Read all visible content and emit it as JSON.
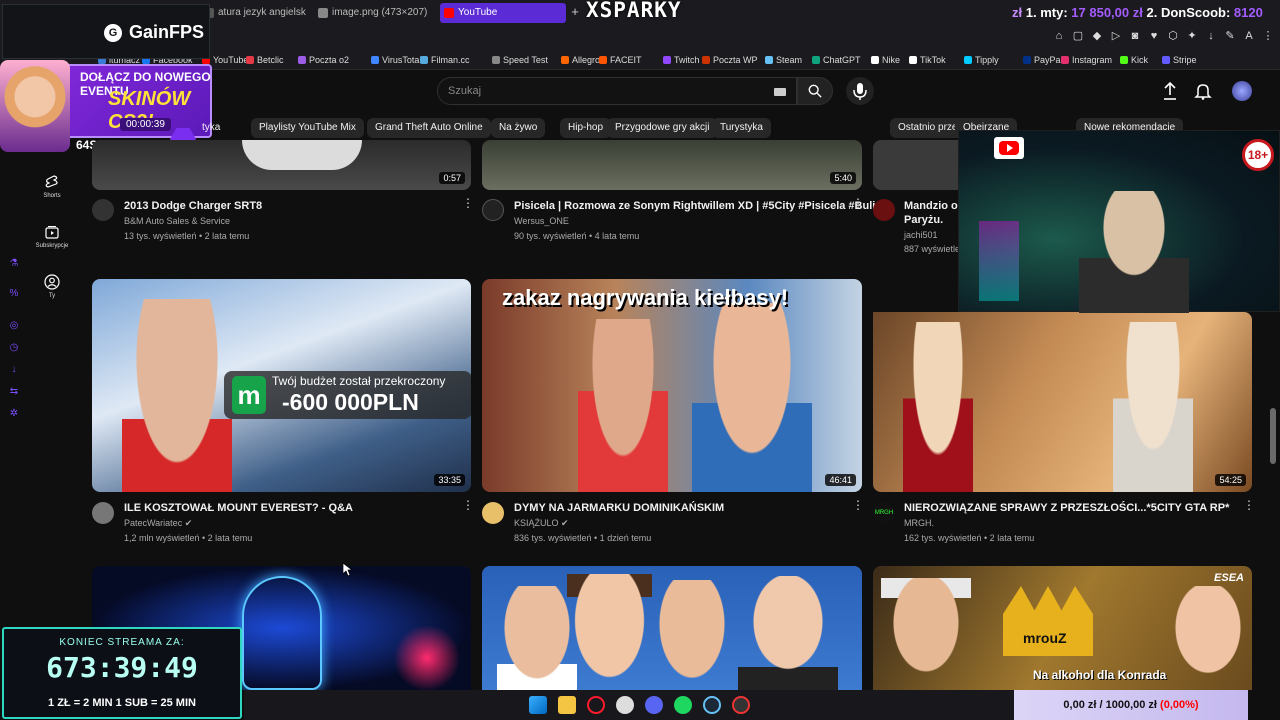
{
  "browser": {
    "tabs": [
      {
        "label": "atura jezyk angielski 202"
      },
      {
        "label": "image.png (473×207)"
      },
      {
        "label": "YouTube"
      }
    ],
    "overlay_title": "XSPARKY",
    "donors": {
      "rank1": "1.",
      "name1": "mty:",
      "amt1": "17 850,00 zł",
      "rank2": "2.",
      "name2": "DonScoob:",
      "amt2": "8120",
      "prefix": "zł"
    },
    "bookmarks": [
      "itumacz",
      "Facebook",
      "YouTube",
      "Betclic",
      "Poczta o2",
      "VirusTotal",
      "Filman.cc",
      "Speed Test",
      "Allegro",
      "FACEIT",
      "Twitch",
      "Poczta WP",
      "Steam",
      "ChatGPT",
      "Nike",
      "TikTok",
      "Tipply",
      "PayPal",
      "Instagram",
      "Kick",
      "Stripe"
    ]
  },
  "gainfps": {
    "label": "GainFPS"
  },
  "promo": {
    "line1": "DOŁĄCZ DO NOWEGO EVENTU",
    "line2": "SKINÓW CS2!",
    "timer": "00:00:39",
    "brand": "64SKINS"
  },
  "youtube": {
    "search_placeholder": "Szukaj",
    "chips": [
      "tyka",
      "Playlisty YouTube Mix",
      "Grand Theft Auto Online",
      "Na żywo",
      "Hip-hop",
      "Przygodowe gry akcji",
      "Turystyka",
      "Ostatnio przesłane",
      "Obejrzane",
      "Nowe rekomendacje"
    ],
    "nav": [
      {
        "label": "Shorts"
      },
      {
        "label": "Subskrypcje"
      },
      {
        "label": "Ty"
      }
    ],
    "row1": [
      {
        "title": "2013 Dodge Charger SRT8",
        "channel": "B&M Auto Sales & Service",
        "meta": "13 tys. wyświetleń • 2 lata temu",
        "duration": "0:57"
      },
      {
        "title": "Pisicela | Rozmowa ze Sonym Rightwillem XD | #5City #Pisicela #Buli",
        "channel": "Wersus_ONE",
        "meta": "90 tys. wyświetleń • 4 lata temu",
        "duration": "5:40"
      },
      {
        "title": "Mandzio og",
        "title2": "Paryżu.",
        "channel": "jachi501",
        "meta": "887 wyświetle"
      }
    ],
    "row2": [
      {
        "title": "ILE KOSZTOWAŁ MOUNT EVEREST? - Q&A",
        "channel": "PatecWariatec",
        "meta": "1,2 mln wyświetleń • 2 lata temu",
        "duration": "33:35",
        "overlay1": "Twój budżet został przekroczony",
        "overlay2": "-600 000PLN"
      },
      {
        "title": "DYMY NA JARMARKU DOMINIKAŃSKIM",
        "channel": "KSIĄŻULO",
        "meta": "836 tys. wyświetleń • 1 dzień temu",
        "duration": "46:41",
        "overlay1": "zakaz nagrywania kiełbasy!"
      },
      {
        "title": "NIEROZWIĄZANE SPRAWY Z PRZESZŁOŚCI...*5CITY GTA RP*",
        "channel": "MRGH.",
        "meta": "162 tys. wyświetleń • 2 lata temu",
        "duration": "54:25"
      }
    ],
    "row3": [
      {
        "overlay1": ""
      },
      {
        "overlay1": ""
      },
      {
        "overlay1": "mrouZ",
        "overlay2": "Na alkohol dla Konrada",
        "overlay3": "ESEA"
      }
    ]
  },
  "age_badge": "18+",
  "countdown": {
    "label": "KONIEC STREAMA ZA:",
    "time": "673:39:49",
    "rule": "1 ZŁ = 2 MIN   1 SUB = 25 MIN"
  },
  "goal": {
    "text": "0,00 zł / 1000,00 zł",
    "pct": "(0,00%)"
  }
}
